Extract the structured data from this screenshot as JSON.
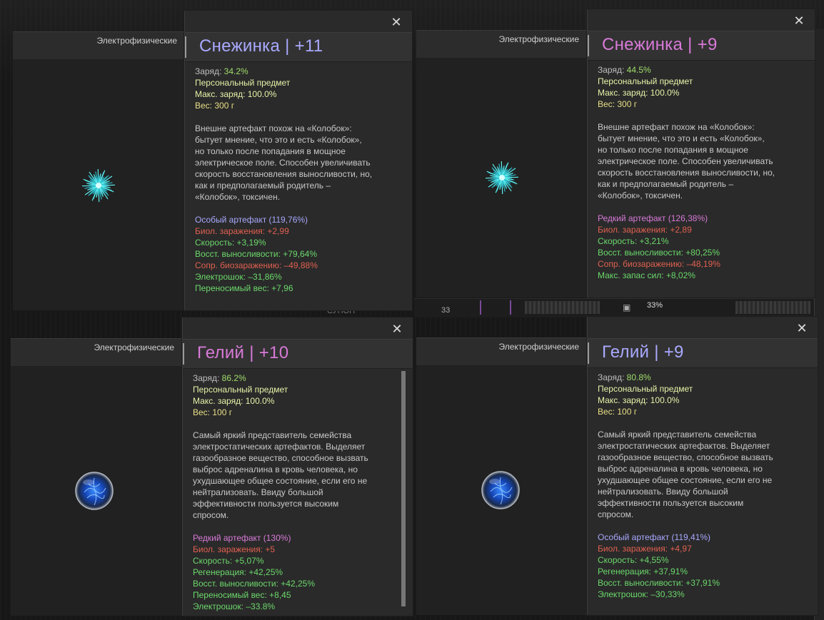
{
  "cards": [
    {
      "category": "Электрофизические",
      "title": "Снежинка | +11",
      "title_color": "#a9a9ff",
      "charge_label": "Заряд:",
      "charge_value": "34.2%",
      "personal": "Персональный предмет",
      "max_charge": "Макс. заряд: 100.0%",
      "weight": "Вес: 300 г",
      "description": [
        "Внешне артефакт похож на «Колобок»:",
        "бытует мнение, что это и есть «Колобок»,",
        "но только после попадания в мощное",
        "электрическое поле. Способен увеличивать",
        "скорость восстановления выносливости, но,",
        "как и предполагаемый родитель –",
        "«Колобок», токсичен."
      ],
      "rarity": "Особый артефакт (119,76%)",
      "rarity_color": "#a8a8ff",
      "stats": [
        {
          "text": "Биол. заражения: +2,99",
          "kind": "bad"
        },
        {
          "text": "Скорость: +3,19%",
          "kind": "good"
        },
        {
          "text": "Восст. выносливости: +79,64%",
          "kind": "good"
        },
        {
          "text": "Сопр. биозаражению: –49,88%",
          "kind": "bad"
        },
        {
          "text": "Электрошок: –31,86%",
          "kind": "good"
        },
        {
          "text": "Переносимый вес: +7,96",
          "kind": "good"
        }
      ],
      "artifact_icon": "snowflake-artifact-icon"
    },
    {
      "category": "Электрофизические",
      "title": "Снежинка | +9",
      "title_color": "#d87ad8",
      "charge_label": "Заряд:",
      "charge_value": "44.5%",
      "personal": "Персональный предмет",
      "max_charge": "Макс. заряд: 100.0%",
      "weight": "Вес: 300 г",
      "description": [
        "Внешне артефакт похож на «Колобок»:",
        "бытует мнение, что это и есть «Колобок»,",
        "но только после попадания в мощное",
        "электрическое поле. Способен увеличивать",
        "скорость восстановления выносливости, но,",
        "как и предполагаемый родитель –",
        "«Колобок», токсичен."
      ],
      "rarity": "Редкий артефакт (126,38%)",
      "rarity_color": "#d87ad8",
      "stats": [
        {
          "text": "Биол. заражения: +2,89",
          "kind": "bad"
        },
        {
          "text": "Скорость: +3,21%",
          "kind": "good"
        },
        {
          "text": "Восст. выносливости: +80,25%",
          "kind": "good"
        },
        {
          "text": "Сопр. биозаражению: –48,19%",
          "kind": "bad"
        },
        {
          "text": "Макс. запас сил: +8,02%",
          "kind": "good"
        }
      ],
      "artifact_icon": "snowflake-artifact-icon"
    },
    {
      "category": "Электрофизические",
      "title": "Гелий | +10",
      "title_color": "#d87ad8",
      "charge_label": "Заряд:",
      "charge_value": "86.2%",
      "personal": "Персональный предмет",
      "max_charge": "Макс. заряд: 100.0%",
      "weight": "Вес: 100 г",
      "description": [
        "Самый яркий представитель семейства",
        "электростатических артефактов. Выделяет",
        "газообразное вещество, способное вызвать",
        "выброс адреналина в кровь человека, но",
        "ухудшающее общее состояние, если его не",
        "нейтрализовать. Ввиду большой",
        "эффективности пользуется высоким",
        "спросом."
      ],
      "rarity": "Редкий артефакт (130%)",
      "rarity_color": "#d87ad8",
      "stats": [
        {
          "text": "Биол. заражения: +5",
          "kind": "bad"
        },
        {
          "text": "Скорость: +5,07%",
          "kind": "good"
        },
        {
          "text": "Регенерация: +42,25%",
          "kind": "good"
        },
        {
          "text": "Восст. выносливости: +42,25%",
          "kind": "good"
        },
        {
          "text": "Переносимый вес: +8,45",
          "kind": "good"
        },
        {
          "text": "Электрошок: –33.8%",
          "kind": "good"
        }
      ],
      "artifact_icon": "helium-artifact-icon"
    },
    {
      "category": "Электрофизические",
      "title": "Гелий | +9",
      "title_color": "#a9a9ff",
      "charge_label": "Заряд:",
      "charge_value": "80.8%",
      "personal": "Персональный предмет",
      "max_charge": "Макс. заряд: 100.0%",
      "weight": "Вес: 100 г",
      "description": [
        "Самый яркий представитель семейства",
        "электростатических артефактов. Выделяет",
        "газообразное вещество, способное вызвать",
        "выброс адреналина в кровь человека, но",
        "ухудшающее общее состояние, если его не",
        "нейтрализовать. Ввиду большой",
        "эффективности пользуется высоким",
        "спросом."
      ],
      "rarity": "Особый артефакт (119,41%)",
      "rarity_color": "#a8a8ff",
      "stats": [
        {
          "text": "Биол. заражения: +4,97",
          "kind": "bad"
        },
        {
          "text": "Скорость: +4,55%",
          "kind": "good"
        },
        {
          "text": "Регенерация: +37,91%",
          "kind": "good"
        },
        {
          "text": "Восст. выносливости: +37,91%",
          "kind": "good"
        },
        {
          "text": "Электрошок: –30,33%",
          "kind": "good"
        }
      ],
      "artifact_icon": "helium-artifact-icon"
    }
  ],
  "background": {
    "slot_count": "33",
    "slot_percent": "33%",
    "stub_text": "СУНОН"
  },
  "colors": {
    "good": "#6bd86b",
    "bad": "#e06050",
    "charge": "#9fdc6a",
    "personal": "#e6f3a8",
    "weight": "#e9df86"
  }
}
